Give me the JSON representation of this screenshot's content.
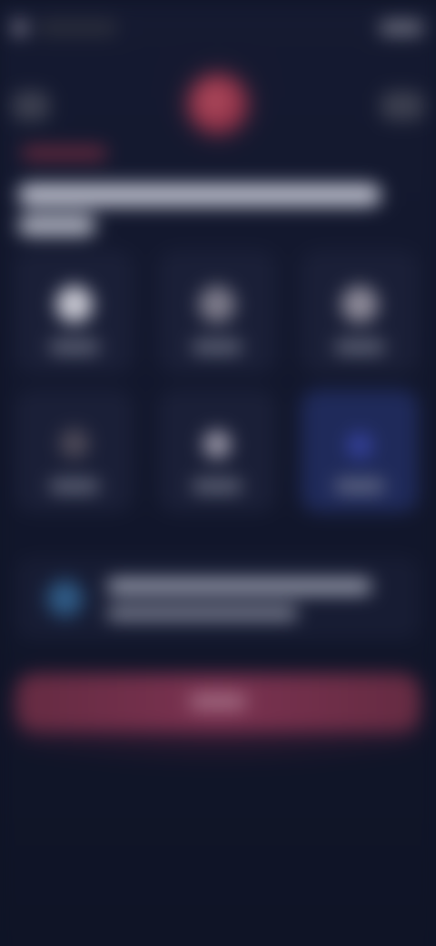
{
  "header": {
    "status_icon": "settings-icon",
    "status_label": "",
    "time_label": ""
  },
  "nav": {
    "back_icon": "back-icon",
    "menu_icon": "menu-icon",
    "hero_icon": "profile-icon"
  },
  "content": {
    "eyebrow": "",
    "headline_line_1": "",
    "headline_line_2": ""
  },
  "tiles": [
    {
      "icon": "circle-icon",
      "label": ""
    },
    {
      "icon": "user-icon",
      "label": ""
    },
    {
      "icon": "user-icon",
      "label": ""
    },
    {
      "icon": "user-icon",
      "label": ""
    },
    {
      "icon": "user-icon",
      "label": ""
    },
    {
      "icon": "user-icon",
      "label": ""
    }
  ],
  "info": {
    "icon": "info-icon",
    "line_1": "",
    "line_2": ""
  },
  "cta": {
    "label": ""
  },
  "colors": {
    "background": "#0f1426",
    "accent": "#7a3250",
    "info_accent": "#2f5b86",
    "selected_tile": "#1f2a5a"
  }
}
